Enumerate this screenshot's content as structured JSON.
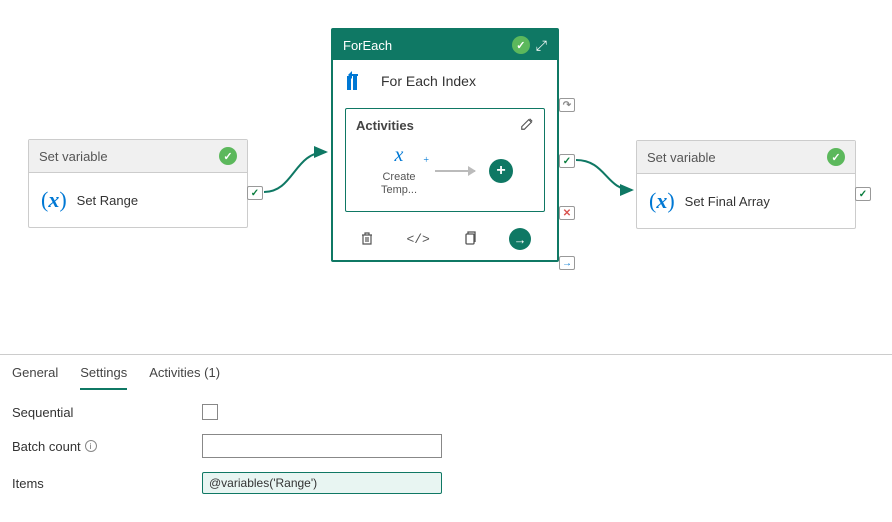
{
  "nodes": {
    "setRange": {
      "type": "Set variable",
      "title": "Set Range"
    },
    "forEach": {
      "header": "ForEach",
      "title": "For Each Index",
      "activitiesLabel": "Activities",
      "innerActivity": "Create Temp..."
    },
    "setFinal": {
      "type": "Set variable",
      "title": "Set Final Array"
    }
  },
  "tabs": {
    "general": "General",
    "settings": "Settings",
    "activities": "Activities (1)"
  },
  "form": {
    "sequentialLabel": "Sequential",
    "batchCountLabel": "Batch count",
    "batchCountValue": "",
    "itemsLabel": "Items",
    "itemsValue": "@variables('Range')"
  }
}
